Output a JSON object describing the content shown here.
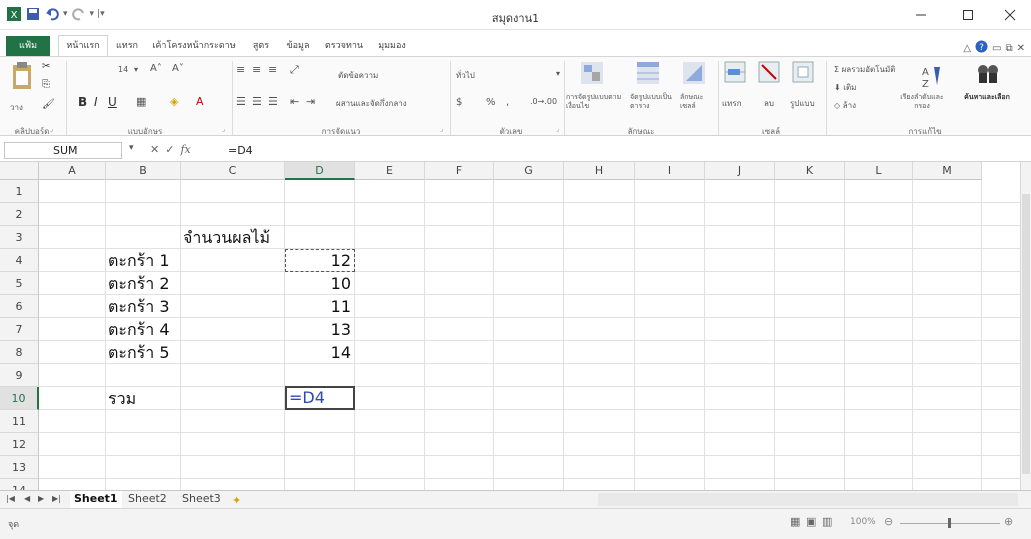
{
  "app": {
    "doc_title": "สมุดงาน1"
  },
  "tabs": [
    "แฟ้ม",
    "หน้าแรก",
    "แทรก",
    "เค้าโครงหน้ากระดาษ",
    "สูตร",
    "ข้อมูล",
    "ตรวจทาน",
    "มุมมอง"
  ],
  "ribbon": {
    "groups": [
      "คลิปบอร์ด",
      "แบบอักษร",
      "การจัดแนว",
      "ตัวเลข",
      "ลักษณะ",
      "เซลล์",
      "การแก้ไข"
    ],
    "paste_label": "วาง",
    "font_size": "14",
    "wrap_text": "ตัดข้อความ",
    "merge_center": "ผสานและจัดกึ่งกลาง",
    "number_format": "ทั่วไป",
    "cond_format": "การจัดรูปแบบตามเงื่อนไข",
    "format_table": "จัดรูปแบบเป็นตาราง",
    "cell_styles": "ลักษณะเซลล์",
    "insert": "แทรก",
    "delete": "ลบ",
    "format": "รูปแบบ",
    "autosum": "Σ ผลรวมอัตโนมัติ",
    "fill": "เติม",
    "clear": "ล้าง",
    "sort_filter": "เรียงลำดับและกรอง",
    "find_select": "ค้นหาและเลือก"
  },
  "formula_bar": {
    "name_box": "SUM",
    "formula": "=D4"
  },
  "columns": [
    "A",
    "B",
    "C",
    "D",
    "E",
    "F",
    "G",
    "H",
    "I",
    "J",
    "K",
    "L",
    "M"
  ],
  "rows": [
    "1",
    "2",
    "3",
    "4",
    "5",
    "6",
    "7",
    "8",
    "9",
    "10",
    "11",
    "12",
    "13",
    "14"
  ],
  "cells": {
    "C3": "จำนวนผลไม้",
    "B4": "ตะกร้า 1",
    "B5": "ตะกร้า 2",
    "B6": "ตะกร้า 3",
    "B7": "ตะกร้า 4",
    "B8": "ตะกร้า 5",
    "D4": "12",
    "D5": "10",
    "D6": "11",
    "D7": "13",
    "D8": "14",
    "B10": "รวม",
    "D10": "=D4"
  },
  "sheets": [
    "Sheet1",
    "Sheet2",
    "Sheet3"
  ],
  "status": {
    "mode": "จุด",
    "zoom": "100%"
  },
  "colors": {
    "accent": "#217346",
    "formula_text": "#2c4bb0"
  }
}
